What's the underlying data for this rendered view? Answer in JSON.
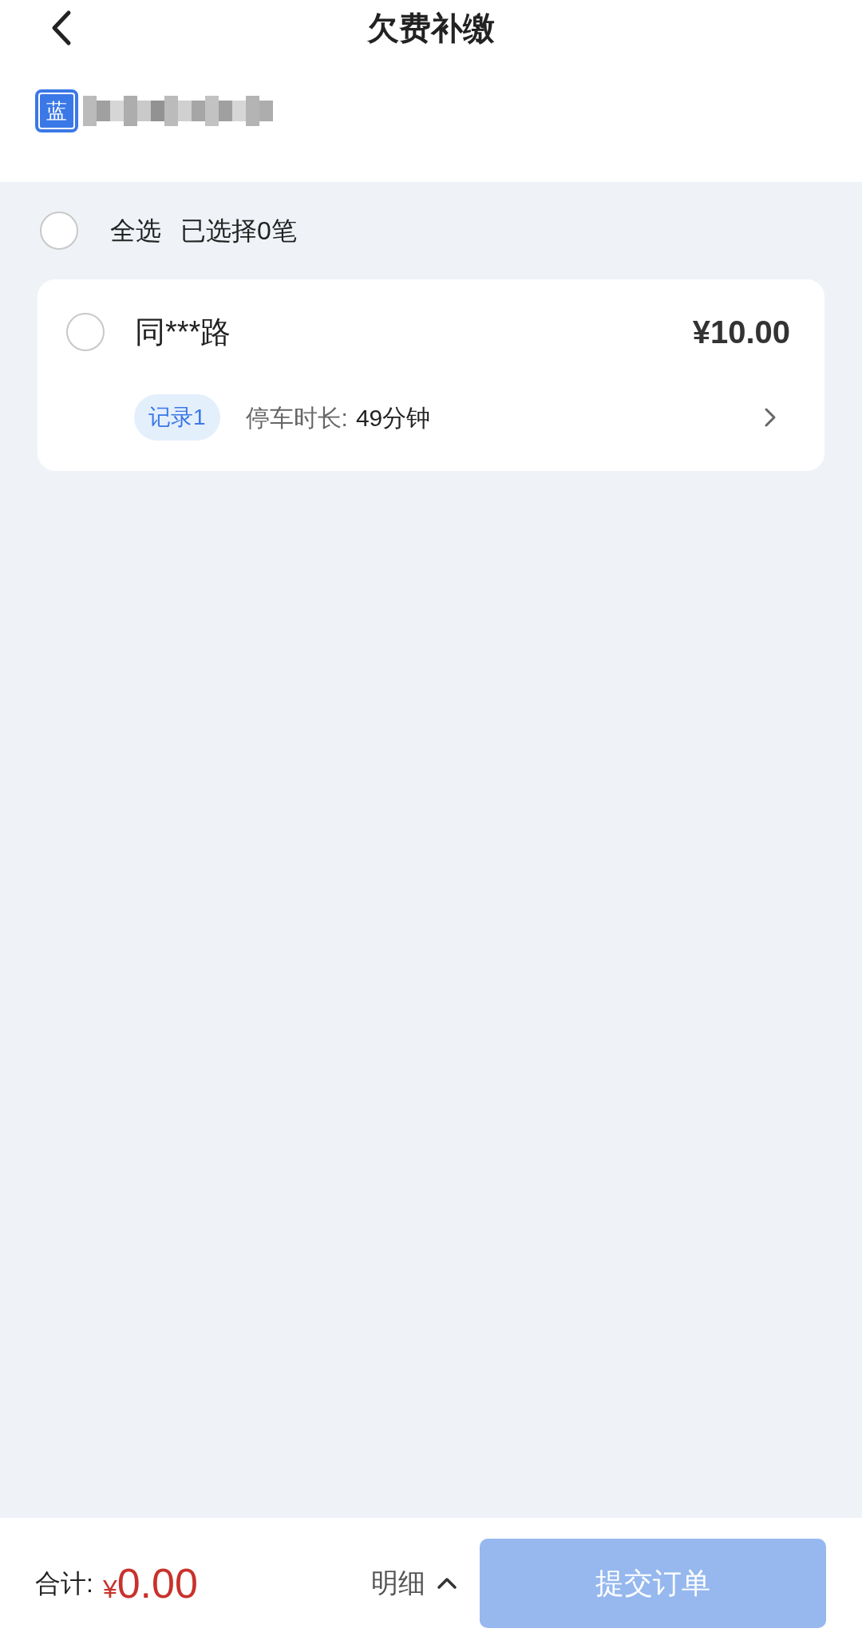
{
  "header": {
    "title": "欠费补缴"
  },
  "plate": {
    "color_label": "蓝"
  },
  "select_all": {
    "label": "全选",
    "checked": false,
    "count_text": "已选择0笔"
  },
  "records": [
    {
      "checked": false,
      "road": "同***路",
      "amount": "¥10.00",
      "tag": "记录1",
      "duration_label": "停车时长:",
      "duration": "49分钟"
    }
  ],
  "footer": {
    "total_label": "合计:",
    "currency": "¥",
    "total": "0.00",
    "detail_label": "明细",
    "submit_label": "提交订单",
    "submit_disabled": true
  }
}
